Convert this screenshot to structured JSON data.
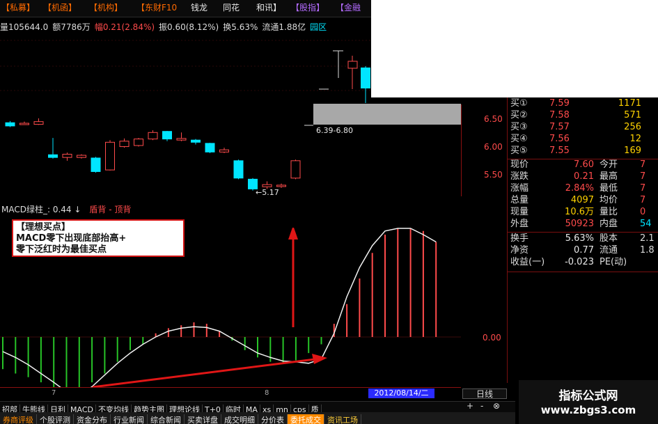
{
  "topbar": {
    "items": [
      {
        "label": "【私募】",
        "color": "orange"
      },
      {
        "label": "【机函】",
        "color": "orange"
      },
      {
        "label": "【机构】",
        "color": "orange"
      },
      {
        "label": "【东财F10",
        "color": "orange"
      },
      {
        "label": "钱龙",
        "color": "white"
      },
      {
        "label": "同花",
        "color": "white"
      },
      {
        "label": "和讯】",
        "color": "white"
      },
      {
        "label": "【股指】",
        "color": "purple"
      },
      {
        "label": "【金融",
        "color": "purple"
      }
    ]
  },
  "infobar": {
    "volume": "量105644.0",
    "amount": "额7786万",
    "change_label": "幅",
    "change_value": "0.21(2.84%)",
    "amplitude": "振0.60(8.12%)",
    "turnover": "换5.63%",
    "float": "流通1.88亿",
    "sector": "园区"
  },
  "chart": {
    "price_axis": [
      "6.50",
      "6.00",
      "5.50"
    ],
    "range_label": "6.39-6.80",
    "low_label": "←5.17",
    "macd_header": "MACD绿柱_: 0.44 ↓",
    "macd_header_right": "盾背 - 顶背",
    "zero_label": "0.00",
    "time_ticks": [
      "7",
      "8"
    ],
    "date_badge": "2012/08/14/二",
    "period": "日线"
  },
  "annotation": {
    "line1": "【理想买点】",
    "line2": "MACD零下出现底部抬高+",
    "line3": "零下泛红时为最佳买点"
  },
  "order_book": [
    {
      "label": "买①",
      "price": "7.59",
      "volume": "1171"
    },
    {
      "label": "买②",
      "price": "7.58",
      "volume": "571"
    },
    {
      "label": "买③",
      "price": "7.57",
      "volume": "256"
    },
    {
      "label": "买④",
      "price": "7.56",
      "volume": "12"
    },
    {
      "label": "买⑤",
      "price": "7.55",
      "volume": "169"
    }
  ],
  "quote": [
    {
      "l1": "现价",
      "v1": "7.60",
      "l2": "今开",
      "v2": "7"
    },
    {
      "l1": "涨跌",
      "v1": "0.21",
      "l2": "最高",
      "v2": "7"
    },
    {
      "l1": "涨幅",
      "v1": "2.84%",
      "l2": "最低",
      "v2": "7"
    },
    {
      "l1": "总量",
      "v1": "4097",
      "l2": "均价",
      "v2": "7"
    },
    {
      "l1": "现量",
      "v1": "10.6万",
      "l2": "量比",
      "v2": "0"
    },
    {
      "l1": "外盘",
      "v1": "50923",
      "l2": "内盘",
      "v2": "54"
    },
    {
      "l1": "换手",
      "v1": "5.63%",
      "l2": "股本",
      "v2": "2.1"
    },
    {
      "l1": "净资",
      "v1": "0.77",
      "l2": "流通",
      "v2": "1.8"
    },
    {
      "l1": "收益(一)",
      "v1": "-0.023",
      "l2": "PE(动)",
      "v2": ""
    }
  ],
  "toolbar": [
    "招部",
    "牛熊线",
    "日利",
    "MACD",
    "不变均线",
    "趋势主图",
    "理想论线",
    "T+0",
    "临时",
    "MA",
    "xs",
    "mn",
    "cps",
    "质"
  ],
  "toolbar_right": [
    "+",
    "-",
    "⊗"
  ],
  "tabs": [
    {
      "label": "券商评级",
      "style": "orange"
    },
    {
      "label": "个股评测",
      "style": "normal"
    },
    {
      "label": "资金分布",
      "style": "normal"
    },
    {
      "label": "行业新闻",
      "style": "normal"
    },
    {
      "label": "综合新闻",
      "style": "normal"
    },
    {
      "label": "买卖详盘",
      "style": "normal"
    },
    {
      "label": "成交明细",
      "style": "normal"
    },
    {
      "label": "分价表",
      "style": "normal"
    },
    {
      "label": "委托成交",
      "style": "active"
    },
    {
      "label": "资讯工场",
      "style": "yellow"
    }
  ],
  "watermark": {
    "line1": "指标公式网",
    "line2": "www.zbgs3.com"
  },
  "colors": {
    "up": "#ff4b4b",
    "down": "#00e5ff",
    "arrow": "#e01616",
    "background": "#000000"
  },
  "candles": [
    {
      "o": 6.42,
      "c": 6.36,
      "h": 6.45,
      "l": 6.34
    },
    {
      "o": 6.4,
      "c": 6.41,
      "h": 6.44,
      "l": 6.38
    },
    {
      "o": 6.39,
      "c": 6.44,
      "h": 6.5,
      "l": 6.38
    },
    {
      "o": 5.83,
      "c": 5.78,
      "h": 6.14,
      "l": 5.76
    },
    {
      "o": 5.78,
      "c": 5.84,
      "h": 5.87,
      "l": 5.72
    },
    {
      "o": 5.78,
      "c": 5.82,
      "h": 5.84,
      "l": 5.76
    },
    {
      "o": 5.77,
      "c": 5.52,
      "h": 5.79,
      "l": 5.5
    },
    {
      "o": 5.55,
      "c": 6.06,
      "h": 6.1,
      "l": 5.54
    },
    {
      "o": 5.98,
      "c": 6.08,
      "h": 6.13,
      "l": 5.96
    },
    {
      "o": 6.0,
      "c": 6.12,
      "h": 6.14,
      "l": 5.98
    },
    {
      "o": 6.12,
      "c": 6.24,
      "h": 6.28,
      "l": 6.1
    },
    {
      "o": 6.26,
      "c": 6.12,
      "h": 6.27,
      "l": 6.08
    },
    {
      "o": 6.1,
      "c": 6.13,
      "h": 6.24,
      "l": 6.08
    },
    {
      "o": 6.1,
      "c": 6.06,
      "h": 6.12,
      "l": 6.02
    },
    {
      "o": 6.04,
      "c": 5.88,
      "h": 6.05,
      "l": 5.86
    },
    {
      "o": 5.88,
      "c": 5.92,
      "h": 5.96,
      "l": 5.86
    },
    {
      "o": 5.72,
      "c": 5.4,
      "h": 5.74,
      "l": 5.38
    },
    {
      "o": 5.38,
      "c": 5.2,
      "h": 5.4,
      "l": 5.17
    },
    {
      "o": 5.24,
      "c": 5.28,
      "h": 5.34,
      "l": 5.2
    },
    {
      "o": 5.25,
      "c": 5.27,
      "h": 5.3,
      "l": 5.22
    },
    {
      "o": 5.4,
      "c": 5.72,
      "h": 5.74,
      "l": 5.38
    }
  ],
  "macd_bars": [
    -0.44,
    -0.5,
    -0.55,
    -0.62,
    -0.7,
    -0.72,
    -0.7,
    -0.62,
    -0.5,
    -0.34,
    -0.18,
    -0.1,
    0.05,
    0.12,
    0.16,
    0.2,
    0.18,
    0.08,
    -0.05,
    -0.18,
    -0.28,
    -0.34,
    -0.36,
    -0.32,
    -0.22,
    -0.1,
    0.18,
    0.45,
    0.8,
    1.15,
    1.4,
    1.55,
    1.52,
    1.45,
    1.3
  ],
  "macd_line": [
    -0.2,
    -0.28,
    -0.38,
    -0.5,
    -0.62,
    -0.75,
    -0.8,
    -0.68,
    -0.52,
    -0.36,
    -0.22,
    -0.1,
    0.0,
    0.08,
    0.12,
    0.14,
    0.13,
    0.08,
    -0.02,
    -0.12,
    -0.22,
    -0.28,
    -0.33,
    -0.34,
    -0.36,
    -0.3,
    0.05,
    0.55,
    0.95,
    1.25,
    1.45,
    1.55,
    1.5,
    1.4,
    1.3
  ]
}
